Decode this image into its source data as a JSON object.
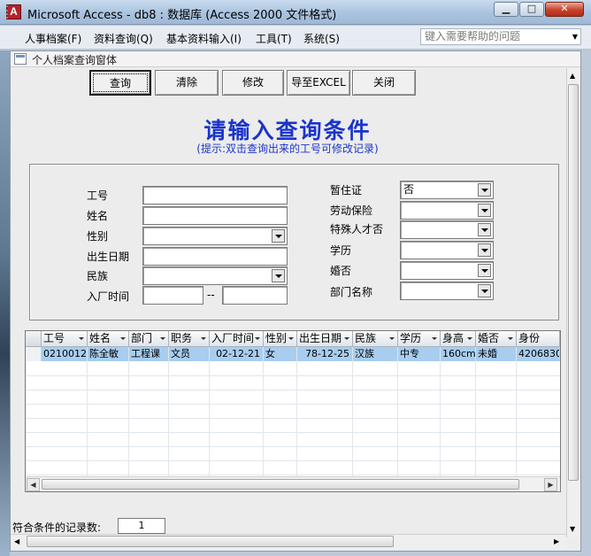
{
  "window": {
    "app_icon": "A",
    "title": "Microsoft Access - db8 : 数据库 (Access 2000 文件格式)",
    "minimize": "▁",
    "maximize": "□",
    "close": "✕"
  },
  "menubar": {
    "items": [
      "人事档案(F)",
      "资料查询(Q)",
      "基本资料输入(I)",
      "工具(T)",
      "系统(S)"
    ],
    "help_placeholder": "键入需要帮助的问题",
    "help_arrow": "▼"
  },
  "form": {
    "title": "个人档案查询窗体",
    "buttons": {
      "query": "查询",
      "clear": "清除",
      "modify": "修改",
      "export": "导至EXCEL",
      "close": "关闭"
    },
    "heading": "请输入查询条件",
    "hint": "(提示:双击查询出来的工号可修改记录)",
    "left_fields": {
      "emp_no": {
        "label": "工号",
        "value": ""
      },
      "name": {
        "label": "姓名",
        "value": ""
      },
      "gender": {
        "label": "性别",
        "value": ""
      },
      "birth": {
        "label": "出生日期",
        "value": ""
      },
      "nation": {
        "label": "民族",
        "value": ""
      },
      "entry": {
        "label": "入厂时间",
        "from": "",
        "sep": "--",
        "to": ""
      }
    },
    "right_fields": {
      "temp_permit": {
        "label": "暂住证",
        "value": "否"
      },
      "labor_insurance": {
        "label": "劳动保险",
        "value": ""
      },
      "special_talent": {
        "label": "特殊人才否",
        "value": ""
      },
      "education": {
        "label": "学历",
        "value": ""
      },
      "marriage": {
        "label": "婚否",
        "value": ""
      },
      "dept": {
        "label": "部门名称",
        "value": ""
      }
    },
    "grid": {
      "columns": [
        "工号",
        "姓名",
        "部门",
        "职务",
        "入厂时间",
        "性别",
        "出生日期",
        "民族",
        "学历",
        "身高",
        "婚否",
        "身份"
      ],
      "rows": [
        [
          "0210012",
          "陈全敏",
          "工程课",
          "文员",
          "02-12-21",
          "女",
          "78-12-25",
          "汉族",
          "中专",
          "160cm",
          "未婚",
          "4206830"
        ]
      ]
    },
    "record_count_label": "符合条件的记录数:",
    "record_count": "1"
  }
}
